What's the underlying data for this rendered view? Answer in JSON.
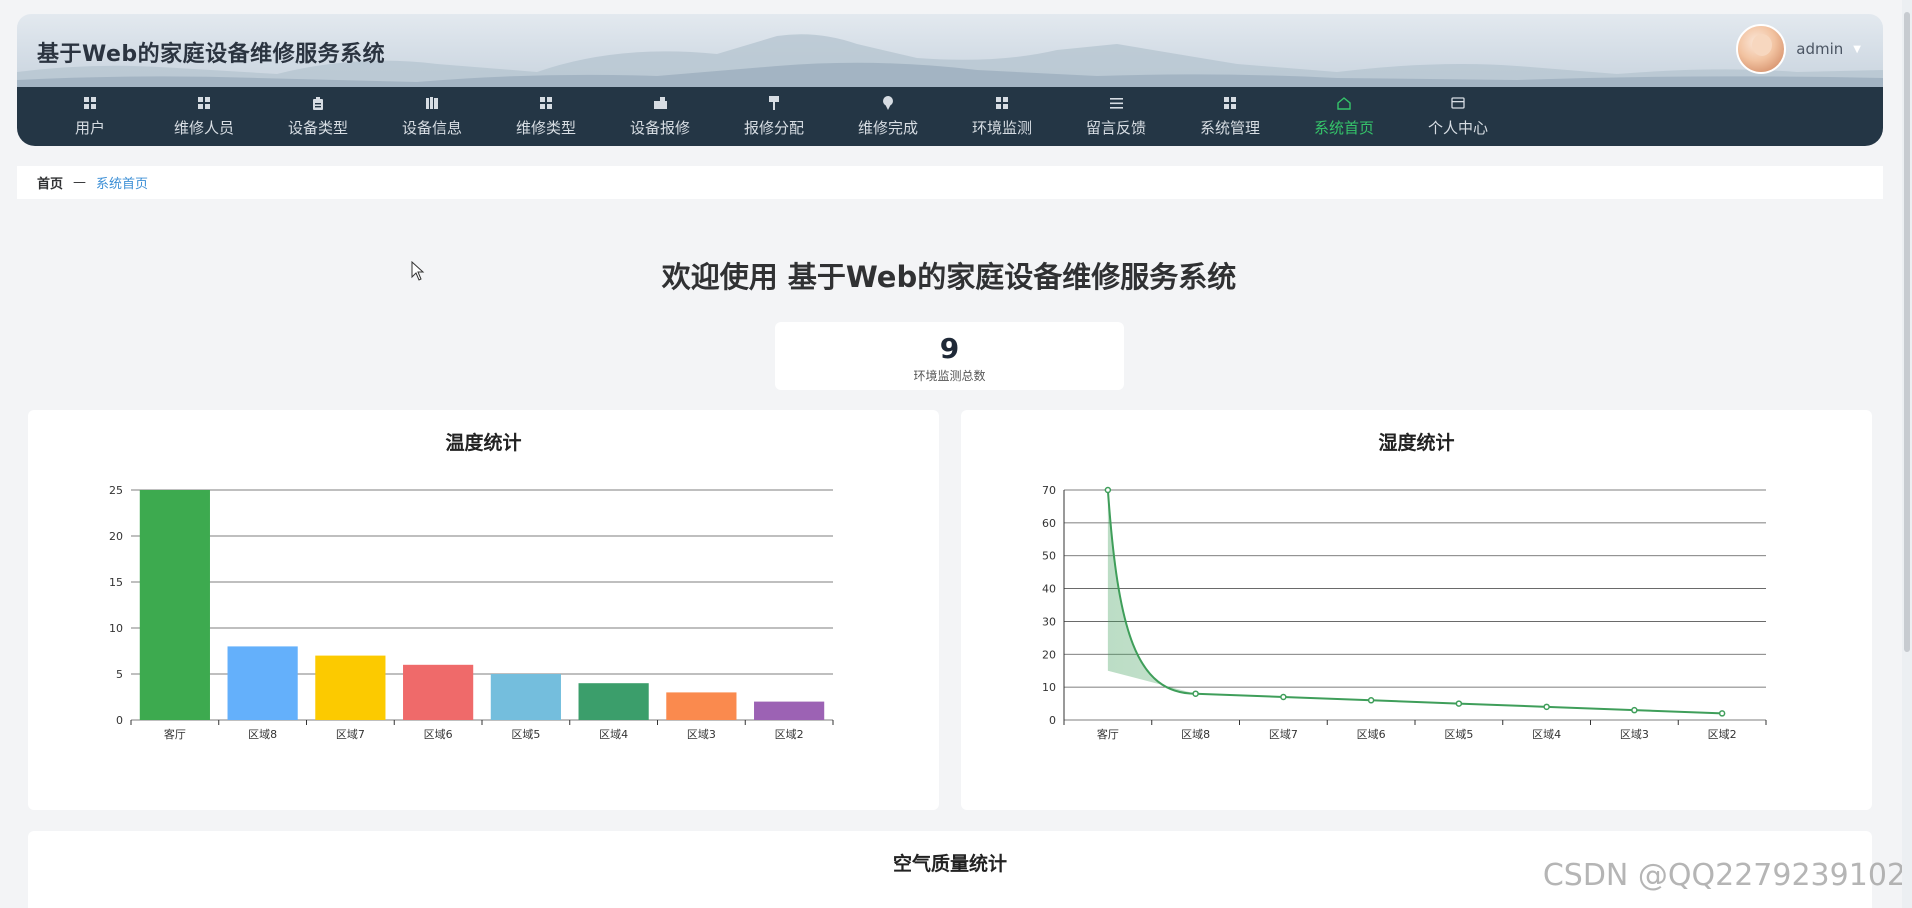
{
  "header": {
    "title": "基于Web的家庭设备维修服务系统",
    "username": "admin",
    "caret": "▼"
  },
  "nav": {
    "items": [
      {
        "label": "用户",
        "icon": "grid-icon"
      },
      {
        "label": "维修人员",
        "icon": "grid-icon"
      },
      {
        "label": "设备类型",
        "icon": "clipboard-icon"
      },
      {
        "label": "设备信息",
        "icon": "book-icon"
      },
      {
        "label": "维修类型",
        "icon": "grid-icon"
      },
      {
        "label": "设备报修",
        "icon": "briefcase-icon"
      },
      {
        "label": "报修分配",
        "icon": "brush-icon"
      },
      {
        "label": "维修完成",
        "icon": "pin-icon"
      },
      {
        "label": "环境监测",
        "icon": "grid-icon"
      },
      {
        "label": "留言反馈",
        "icon": "list-icon"
      },
      {
        "label": "系统管理",
        "icon": "grid-icon"
      },
      {
        "label": "系统首页",
        "icon": "home-icon",
        "active": true
      },
      {
        "label": "个人中心",
        "icon": "card-icon"
      }
    ],
    "active_color": "#35c46a",
    "bg_color": "#243645"
  },
  "breadcrumb": {
    "home": "首页",
    "sep": "—",
    "current": "系统首页"
  },
  "welcome": "欢迎使用 基于Web的家庭设备维修服务系统",
  "stat": {
    "value": "9",
    "label": "环境监测总数"
  },
  "chart_data": [
    {
      "type": "bar",
      "title": "温度统计",
      "categories": [
        "客厅",
        "区域8",
        "区域7",
        "区域6",
        "区域5",
        "区域4",
        "区域3",
        "区域2"
      ],
      "values": [
        25,
        8,
        7,
        6,
        5,
        4,
        3,
        2
      ],
      "colors": [
        "#3daa4f",
        "#64b0fb",
        "#fcca00",
        "#ef6a6a",
        "#74bedd",
        "#3b9e6b",
        "#fa8a4e",
        "#9c62b4"
      ],
      "ylim": [
        0,
        25
      ],
      "yticks": [
        0,
        5,
        10,
        15,
        20,
        25
      ],
      "grid": true
    },
    {
      "type": "line",
      "title": "湿度统计",
      "categories": [
        "客厅",
        "区域8",
        "区域7",
        "区域6",
        "区域5",
        "区域4",
        "区域3",
        "区域2"
      ],
      "values": [
        70,
        8,
        7,
        6,
        5,
        4,
        3,
        2
      ],
      "color": "#3f9e5a",
      "smooth": true,
      "area": true,
      "ylim": [
        0,
        70
      ],
      "yticks": [
        0,
        10,
        20,
        30,
        40,
        50,
        60,
        70
      ],
      "grid": true
    }
  ],
  "bottom": {
    "title": "空气质量统计"
  },
  "watermark": "CSDN @QQ2279239102"
}
